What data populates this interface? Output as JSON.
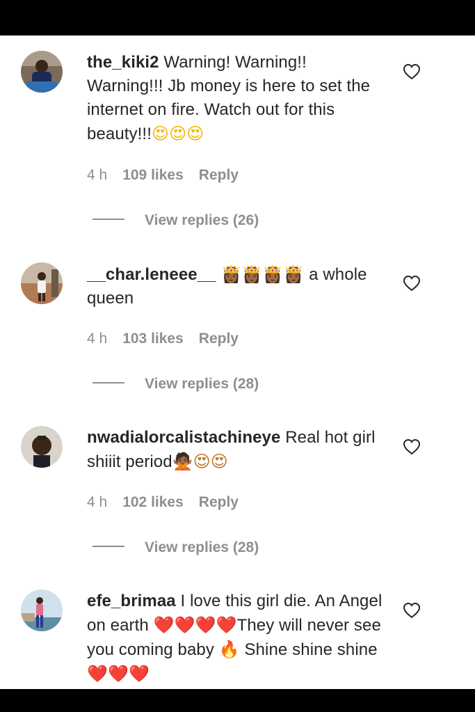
{
  "comments": [
    {
      "username": "the_kiki2",
      "text": "Warning! Warning!! Warning!!! Jb money is here to set the internet on fire. Watch out for this beauty!!!",
      "emoji": "😍😍😍",
      "time": "4 h",
      "likes": "109 likes",
      "reply": "Reply",
      "view_replies": "View replies (26)"
    },
    {
      "username": "__char.leneee__",
      "emoji": "👸🏾👸🏾👸🏾👸🏾",
      "text": "a whole queen",
      "time": "4 h",
      "likes": "103 likes",
      "reply": "Reply",
      "view_replies": "View replies (28)"
    },
    {
      "username": "nwadialorcalistachineye",
      "text": "Real hot girl shiiit period",
      "emoji": "🙅🏾😍😍",
      "time": "4 h",
      "likes": "102 likes",
      "reply": "Reply",
      "view_replies": "View replies (28)"
    },
    {
      "username": "efe_brimaa",
      "text_1": "I love this girl die. An Angel on earth",
      "emoji_1": "❤️❤️❤️❤️",
      "text_2": "They will never see you coming baby",
      "emoji_2": "🔥",
      "text_3": "Shine shine shine",
      "emoji_3": "❤️❤️❤️"
    }
  ],
  "colors": {
    "text": "#262626",
    "secondary": "#8e8e8e",
    "background": "#ffffff",
    "bars": "#000000"
  },
  "icons": {
    "like": "heart-outline-icon"
  }
}
